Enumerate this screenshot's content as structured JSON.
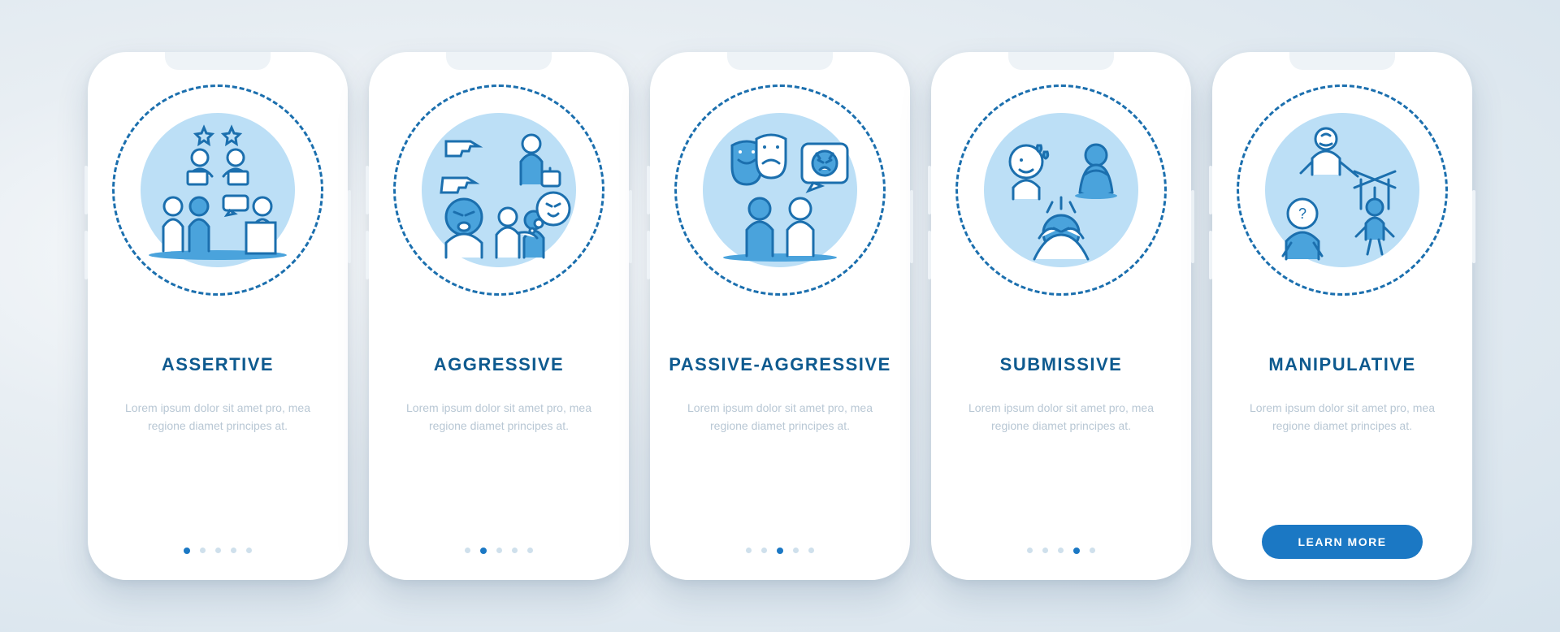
{
  "colors": {
    "brand": "#1b78c4",
    "brand_dark": "#0e5a8f",
    "muted": "#b8c7d4"
  },
  "screens": [
    {
      "id": "assertive",
      "title": "ASSERTIVE",
      "body": "Lorem ipsum dolor sit amet pro, mea regione diamet principes at.",
      "icon": "assertive-illustration",
      "active_index": 0,
      "cta": null
    },
    {
      "id": "aggressive",
      "title": "AGGRESSIVE",
      "body": "Lorem ipsum dolor sit amet pro, mea regione diamet principes at.",
      "icon": "aggressive-illustration",
      "active_index": 1,
      "cta": null
    },
    {
      "id": "passive-aggressive",
      "title": "PASSIVE-AGGRESSIVE",
      "body": "Lorem ipsum dolor sit amet pro, mea regione diamet principes at.",
      "icon": "passive-aggressive-illustration",
      "active_index": 2,
      "cta": null
    },
    {
      "id": "submissive",
      "title": "SUBMISSIVE",
      "body": "Lorem ipsum dolor sit amet pro, mea regione diamet principes at.",
      "icon": "submissive-illustration",
      "active_index": 3,
      "cta": null
    },
    {
      "id": "manipulative",
      "title": "MANIPULATIVE",
      "body": "Lorem ipsum dolor sit amet pro, mea regione diamet principes at.",
      "icon": "manipulative-illustration",
      "active_index": 4,
      "cta": "LEARN MORE"
    }
  ],
  "page_count": 5
}
